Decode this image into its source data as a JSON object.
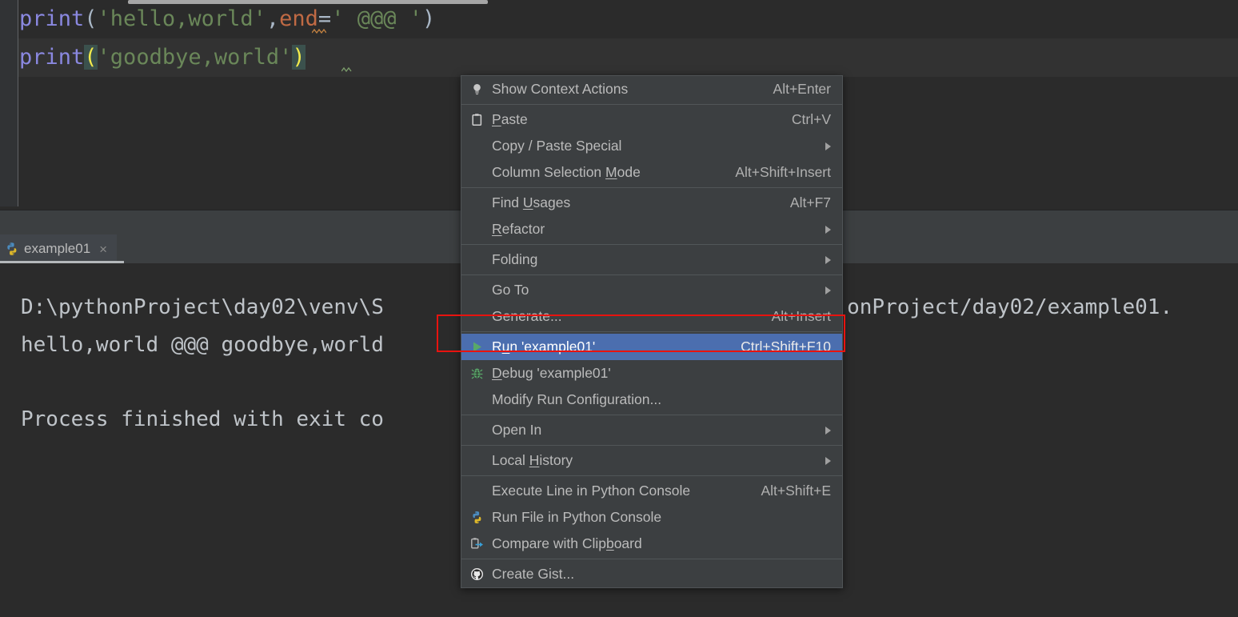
{
  "editor": {
    "name": "python-code-editor",
    "lines": [
      {
        "id": "line-1",
        "tokens": [
          {
            "t": "print",
            "c": "fn"
          },
          {
            "t": "(",
            "c": "paren"
          },
          {
            "t": "'hello,world'",
            "c": "str"
          },
          {
            "t": ",",
            "c": "comma"
          },
          {
            "t": "end",
            "c": "kwarg"
          },
          {
            "t": "=",
            "c": "eq"
          },
          {
            "t": "' @@@ '",
            "c": "str"
          },
          {
            "t": ")",
            "c": "paren"
          }
        ],
        "text": "print('hello,world',end=' @@@ ')"
      },
      {
        "id": "line-2",
        "tokens": [
          {
            "t": "print",
            "c": "fn"
          },
          {
            "t": "(",
            "c": "brace"
          },
          {
            "t": "'goodbye,world'",
            "c": "str"
          },
          {
            "t": ")",
            "c": "brace"
          }
        ],
        "text": "print('goodbye,world')"
      }
    ],
    "colors": {
      "background": "#2b2b2b",
      "current_line": "#323232",
      "gutter": "#313335",
      "function": "#8a88e0",
      "string": "#6a8759",
      "keyword_arg": "#c06a44",
      "punctuation": "#a9b7c6",
      "brace_match_bg": "#3b514d",
      "brace_match_fg": "#f2ea4b"
    }
  },
  "toolwindow": {
    "tab": {
      "label": "example01",
      "icon": "python-file-icon",
      "close": "×"
    },
    "console_lines": [
      "D:\\pythonProject\\day02\\venv\\S                                     onProject/day02/example01.",
      "hello,world @@@ goodbye,world",
      "Process finished with exit co"
    ],
    "console_text_color": "#bfc4c9"
  },
  "context_menu": {
    "name": "editor-context-menu",
    "background": "#3c3f41",
    "selection_color": "#4b6eaf",
    "groups": [
      {
        "items": [
          {
            "label": "Show Context Actions",
            "accel": "Alt+Enter",
            "icon": "lightbulb-icon",
            "mnemonic": "",
            "arrow": false,
            "selected": false
          }
        ]
      },
      {
        "items": [
          {
            "label": "Paste",
            "accel": "Ctrl+V",
            "icon": "clipboard-paste-icon",
            "mnemonic": "P",
            "arrow": false,
            "selected": false
          },
          {
            "label": "Copy / Paste Special",
            "accel": "",
            "icon": "",
            "mnemonic": "",
            "arrow": true,
            "selected": false
          },
          {
            "label": "Column Selection Mode",
            "accel": "Alt+Shift+Insert",
            "icon": "",
            "mnemonic": "M",
            "arrow": false,
            "selected": false
          }
        ]
      },
      {
        "items": [
          {
            "label": "Find Usages",
            "accel": "Alt+F7",
            "icon": "",
            "mnemonic": "U",
            "arrow": false,
            "selected": false
          },
          {
            "label": "Refactor",
            "accel": "",
            "icon": "",
            "mnemonic": "R",
            "arrow": true,
            "selected": false
          }
        ]
      },
      {
        "items": [
          {
            "label": "Folding",
            "accel": "",
            "icon": "",
            "mnemonic": "",
            "arrow": true,
            "selected": false
          }
        ]
      },
      {
        "items": [
          {
            "label": "Go To",
            "accel": "",
            "icon": "",
            "mnemonic": "",
            "arrow": true,
            "selected": false
          },
          {
            "label": "Generate...",
            "accel": "Alt+Insert",
            "icon": "",
            "mnemonic": "",
            "arrow": false,
            "selected": false
          }
        ]
      },
      {
        "items": [
          {
            "label": "Run 'example01'",
            "accel": "Ctrl+Shift+F10",
            "icon": "run-play-icon",
            "mnemonic": "u",
            "arrow": false,
            "selected": true
          },
          {
            "label": "Debug 'example01'",
            "accel": "",
            "icon": "debug-bug-icon",
            "mnemonic": "D",
            "arrow": false,
            "selected": false
          },
          {
            "label": "Modify Run Configuration...",
            "accel": "",
            "icon": "",
            "mnemonic": "",
            "arrow": false,
            "selected": false
          }
        ]
      },
      {
        "items": [
          {
            "label": "Open In",
            "accel": "",
            "icon": "",
            "mnemonic": "",
            "arrow": true,
            "selected": false
          }
        ]
      },
      {
        "items": [
          {
            "label": "Local History",
            "accel": "",
            "icon": "",
            "mnemonic": "H",
            "arrow": true,
            "selected": false
          }
        ]
      },
      {
        "items": [
          {
            "label": "Execute Line in Python Console",
            "accel": "Alt+Shift+E",
            "icon": "",
            "mnemonic": "",
            "arrow": false,
            "selected": false
          },
          {
            "label": "Run File in Python Console",
            "accel": "",
            "icon": "python-icon",
            "mnemonic": "",
            "arrow": false,
            "selected": false
          },
          {
            "label": "Compare with Clipboard",
            "accel": "",
            "icon": "compare-clipboard-icon",
            "mnemonic": "b",
            "arrow": false,
            "selected": false
          }
        ]
      },
      {
        "items": [
          {
            "label": "Create Gist...",
            "accel": "",
            "icon": "github-icon",
            "mnemonic": "",
            "arrow": false,
            "selected": false
          }
        ]
      }
    ]
  },
  "annotation": {
    "name": "red-highlight-rectangle",
    "color": "#e8130f",
    "targets": "Run 'example01'"
  }
}
